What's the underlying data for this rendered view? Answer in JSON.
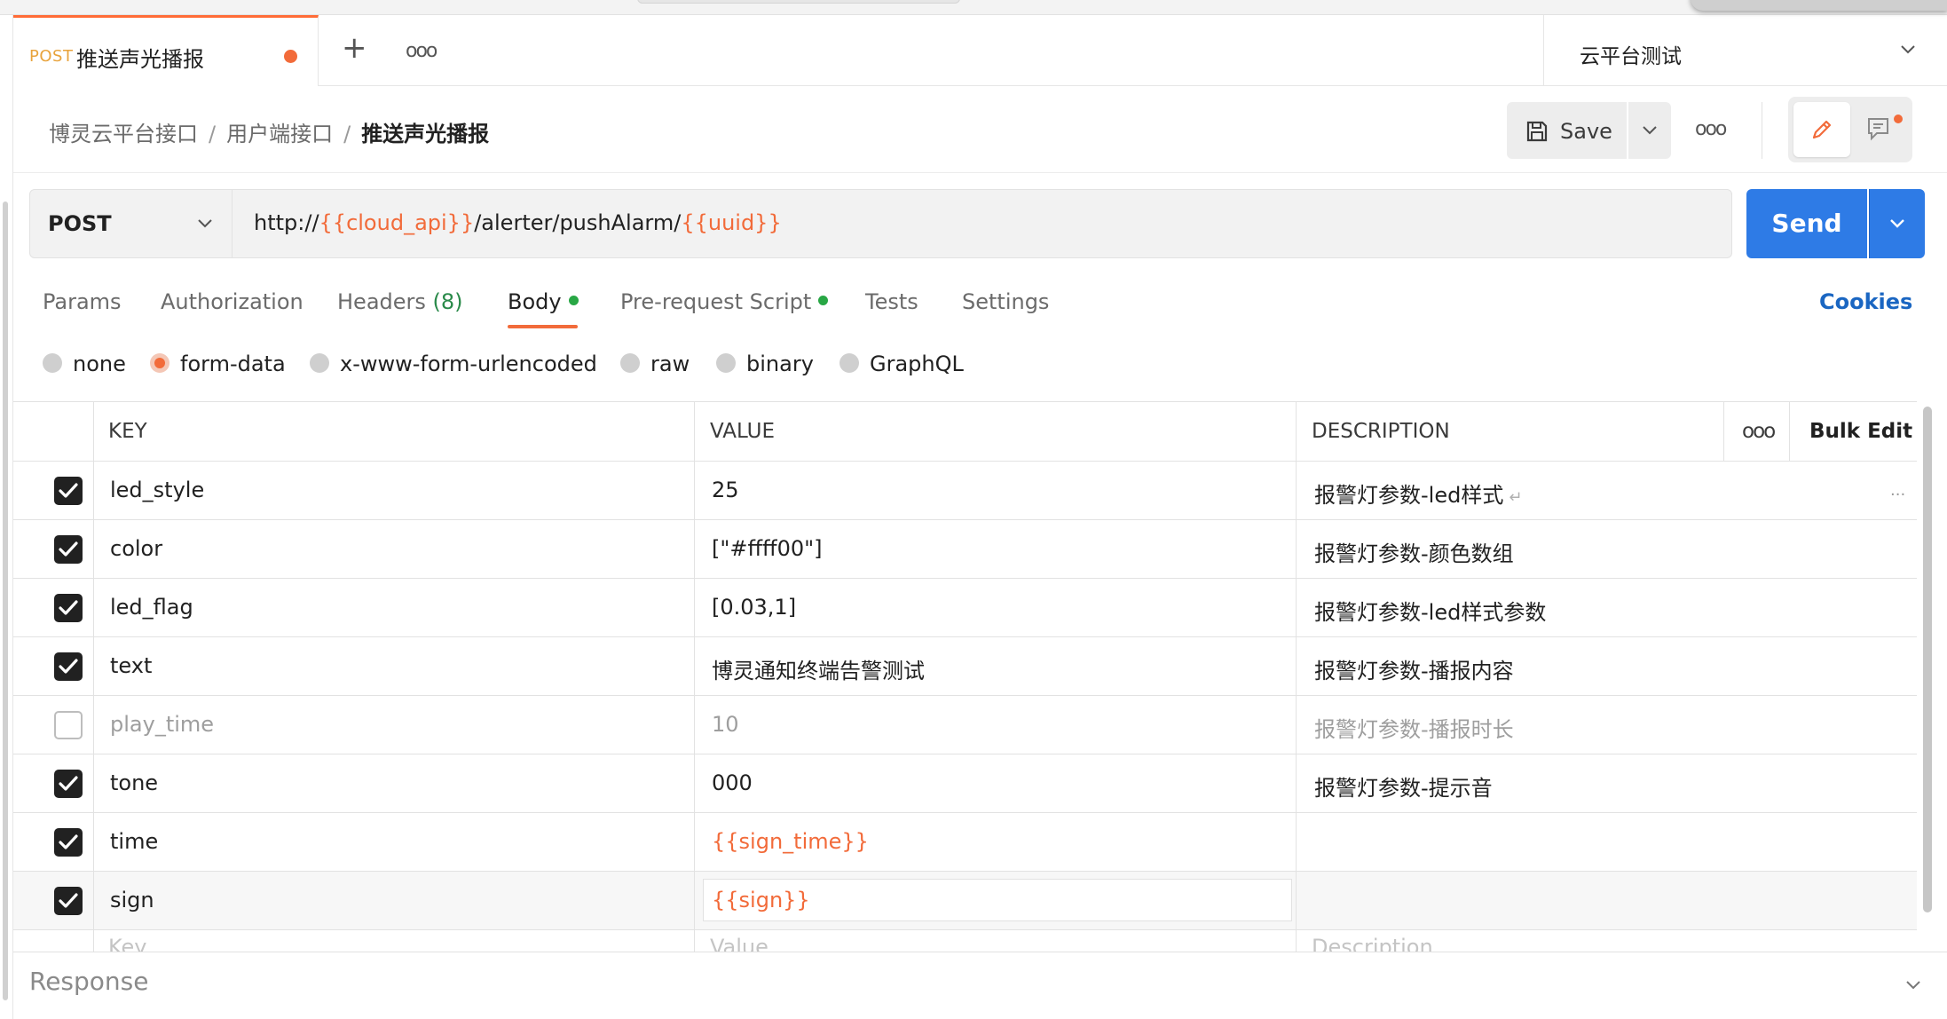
{
  "tab": {
    "method": "POST",
    "name": "推送声光播报",
    "add": "+",
    "more": "ooo"
  },
  "environment": {
    "name": "云平台测试"
  },
  "breadcrumb": {
    "items": [
      "博灵云平台接口",
      "用户端接口"
    ],
    "separator": "/",
    "current": "推送声光播报"
  },
  "toolbar": {
    "save_label": "Save",
    "more": "ooo"
  },
  "request": {
    "method": "POST",
    "url_parts": [
      {
        "text": "http://",
        "var": false
      },
      {
        "text": "{{cloud_api}}",
        "var": true
      },
      {
        "text": "/alerter/pushAlarm/",
        "var": false
      },
      {
        "text": "{{uuid}}",
        "var": true
      }
    ],
    "send_label": "Send"
  },
  "req_tabs": [
    {
      "label": "Params"
    },
    {
      "label": "Authorization"
    },
    {
      "label": "Headers",
      "count": "(8)"
    },
    {
      "label": "Body",
      "active": true,
      "dot": true
    },
    {
      "label": "Pre-request Script",
      "dot": true
    },
    {
      "label": "Tests"
    },
    {
      "label": "Settings"
    }
  ],
  "cookies_label": "Cookies",
  "body_types": [
    {
      "label": "none",
      "selected": false
    },
    {
      "label": "form-data",
      "selected": true
    },
    {
      "label": "x-www-form-urlencoded",
      "selected": false
    },
    {
      "label": "raw",
      "selected": false
    },
    {
      "label": "binary",
      "selected": false
    },
    {
      "label": "GraphQL",
      "selected": false
    }
  ],
  "table": {
    "headers": {
      "key": "KEY",
      "value": "VALUE",
      "description": "DESCRIPTION",
      "more": "ooo",
      "bulk_edit": "Bulk Edit"
    },
    "rows": [
      {
        "checked": true,
        "key": "led_style",
        "value": "25",
        "description": "报警灯参数-led样式",
        "value_is_var": false,
        "enter": "↵",
        "ellipsis": "..."
      },
      {
        "checked": true,
        "key": "color",
        "value": "[\"#ffff00\"]",
        "description": "报警灯参数-颜色数组",
        "value_is_var": false
      },
      {
        "checked": true,
        "key": "led_flag",
        "value": "[0.03,1]",
        "description": "报警灯参数-led样式参数",
        "value_is_var": false
      },
      {
        "checked": true,
        "key": "text",
        "value": "博灵通知终端告警测试",
        "description": "报警灯参数-播报内容",
        "value_is_var": false
      },
      {
        "checked": false,
        "key": "play_time",
        "value": "10",
        "description": "报警灯参数-播报时长",
        "value_is_var": false
      },
      {
        "checked": true,
        "key": "tone",
        "value": "000",
        "description": "报警灯参数-提示音",
        "value_is_var": false
      },
      {
        "checked": true,
        "key": "time",
        "value": "{{sign_time}}",
        "description": "",
        "value_is_var": true
      },
      {
        "checked": true,
        "key": "sign",
        "value": "{{sign}}",
        "description": "",
        "value_is_var": true,
        "editing": true
      }
    ],
    "placeholder": {
      "key": "Key",
      "value": "Value",
      "description": "Description"
    }
  },
  "response": {
    "label": "Response"
  },
  "colors": {
    "accent": "#f26b3a",
    "send": "#2e7be6",
    "var": "#f26b3a",
    "link": "#1a66c2",
    "green": "#28a745"
  }
}
